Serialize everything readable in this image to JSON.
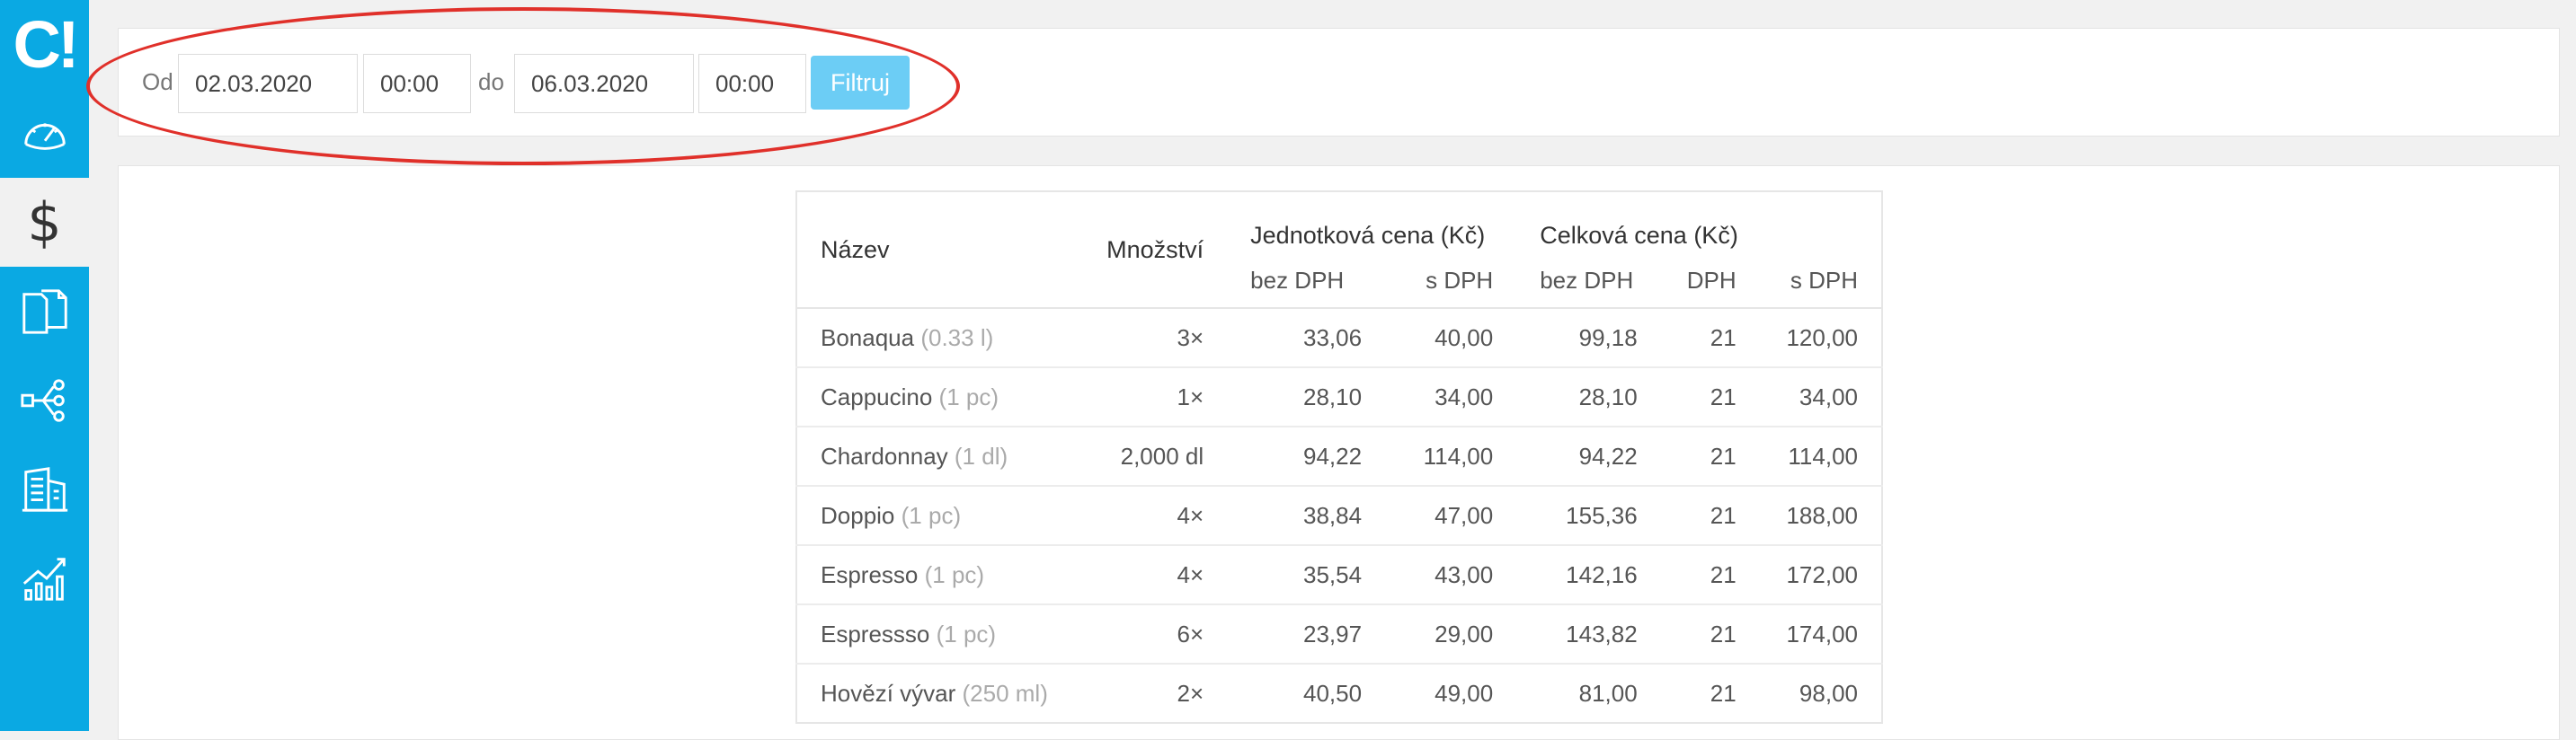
{
  "sidebar": {
    "logo": "C!",
    "items": [
      {
        "icon": "speedometer-icon"
      },
      {
        "icon": "dollar-icon",
        "glyph": "$",
        "active": true
      },
      {
        "icon": "documents-icon"
      },
      {
        "icon": "network-icon"
      },
      {
        "icon": "building-icon"
      },
      {
        "icon": "chart-icon"
      }
    ]
  },
  "filter": {
    "from_label": "Od",
    "from_date": "02.03.2020",
    "from_time": "00:00",
    "to_label": "do",
    "to_date": "06.03.2020",
    "to_time": "00:00",
    "button_label": "Filtruj"
  },
  "table": {
    "headers": {
      "name": "Název",
      "quantity": "Množství",
      "unit_price": "Jednotková cena (Kč)",
      "total_price": "Celková cena (Kč)",
      "sub": [
        "bez DPH",
        "s DPH",
        "bez DPH",
        "DPH",
        "s DPH"
      ]
    },
    "rows": [
      {
        "name": "Bonaqua",
        "unit": "(0.33 l)",
        "qty": "3×",
        "unit_net": "33,06",
        "unit_gross": "40,00",
        "total_net": "99,18",
        "vat": "21",
        "total_gross": "120,00"
      },
      {
        "name": "Cappucino",
        "unit": "(1 pc)",
        "qty": "1×",
        "unit_net": "28,10",
        "unit_gross": "34,00",
        "total_net": "28,10",
        "vat": "21",
        "total_gross": "34,00"
      },
      {
        "name": "Chardonnay",
        "unit": "(1 dl)",
        "qty": "2,000 dl",
        "unit_net": "94,22",
        "unit_gross": "114,00",
        "total_net": "94,22",
        "vat": "21",
        "total_gross": "114,00"
      },
      {
        "name": "Doppio",
        "unit": "(1 pc)",
        "qty": "4×",
        "unit_net": "38,84",
        "unit_gross": "47,00",
        "total_net": "155,36",
        "vat": "21",
        "total_gross": "188,00"
      },
      {
        "name": "Espresso",
        "unit": "(1 pc)",
        "qty": "4×",
        "unit_net": "35,54",
        "unit_gross": "43,00",
        "total_net": "142,16",
        "vat": "21",
        "total_gross": "172,00"
      },
      {
        "name": "Espressso",
        "unit": "(1 pc)",
        "qty": "6×",
        "unit_net": "23,97",
        "unit_gross": "29,00",
        "total_net": "143,82",
        "vat": "21",
        "total_gross": "174,00"
      },
      {
        "name": "Hovězí vývar",
        "unit": "(250 ml)",
        "qty": "2×",
        "unit_net": "40,50",
        "unit_gross": "49,00",
        "total_net": "81,00",
        "vat": "21",
        "total_gross": "98,00"
      }
    ]
  },
  "colors": {
    "sidebar": "#0aa9e3",
    "button": "#6ccdf5",
    "annotation": "#e0302a"
  }
}
